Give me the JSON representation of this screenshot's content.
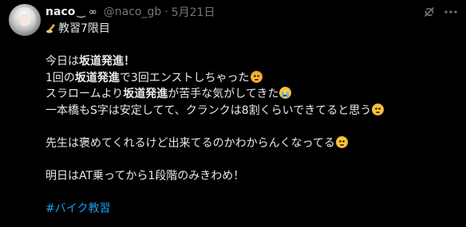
{
  "post": {
    "display_name": "naco",
    "name_decoration": "‿ ∞",
    "handle": "@naco_gb",
    "separator": "·",
    "date": "5月21日",
    "icons": [
      "avatar",
      "grok-icon",
      "more-icon",
      "writing-hand-icon",
      "exploding-head-icon",
      "sob-icon",
      "thinking-icon",
      "pleading-icon"
    ],
    "lines": {
      "l1": "教習7限目",
      "l2_a": "今日は",
      "l2_b": "坂道発進",
      "l2_c": "！",
      "l3_a": "1回の",
      "l3_b": "坂道発進",
      "l3_c": "で3回エンストしちゃった",
      "l4_a": "スラロームより",
      "l4_b": "坂道発進",
      "l4_c": "が苦手な気がしてきた",
      "l5": "一本橋もS字は安定してて、クランクは8割くらいできてると思う",
      "l6": "先生は褒めてくれるけど出来てるのかわからんくなってる",
      "l7": "明日はAT乗ってから1段階のみきわめ！",
      "hashtag": "#バイク教習"
    },
    "colors": {
      "background": "#000000",
      "text": "#e7e9ea",
      "secondary": "#71767b",
      "link": "#1d9bf0"
    }
  }
}
